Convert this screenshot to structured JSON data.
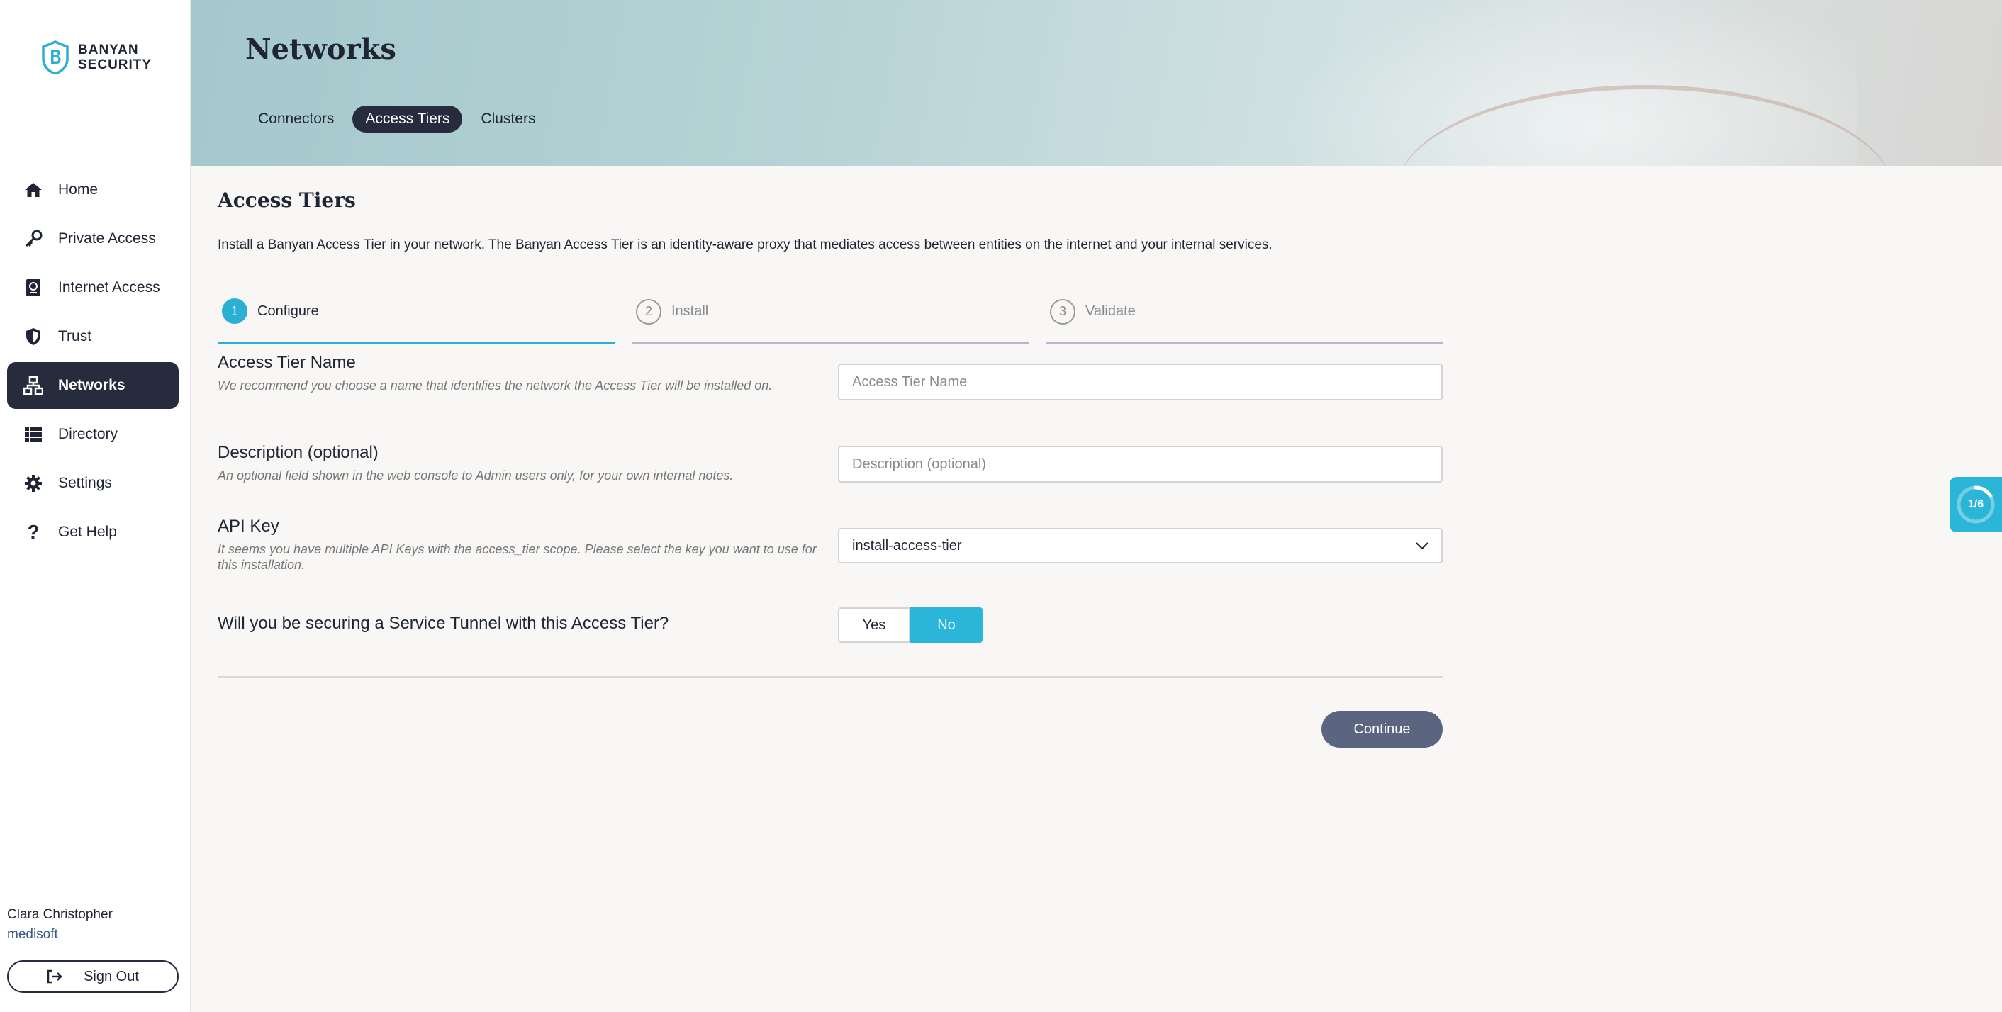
{
  "brand": {
    "line1": "BANYAN",
    "line2": "SECURITY",
    "accent": "#2bafd2"
  },
  "sidebar": {
    "items": [
      {
        "label": "Home",
        "icon": "home-icon"
      },
      {
        "label": "Private Access",
        "icon": "key-icon"
      },
      {
        "label": "Internet Access",
        "icon": "passport-icon"
      },
      {
        "label": "Trust",
        "icon": "shield-icon"
      },
      {
        "label": "Networks",
        "icon": "network-icon",
        "active": true
      },
      {
        "label": "Directory",
        "icon": "list-icon"
      },
      {
        "label": "Settings",
        "icon": "gear-icon"
      },
      {
        "label": "Get Help",
        "icon": "question-icon"
      }
    ],
    "user_name": "Clara Christopher",
    "org": "medisoft",
    "signout_label": "Sign Out"
  },
  "header": {
    "title": "Networks",
    "tabs": [
      {
        "label": "Connectors"
      },
      {
        "label": "Access Tiers",
        "active": true
      },
      {
        "label": "Clusters"
      }
    ]
  },
  "main": {
    "title": "Access Tiers",
    "intro": "Install a Banyan Access Tier in your network. The Banyan Access Tier is an identity-aware proxy that mediates access between entities on the internet and your internal services.",
    "steps": [
      {
        "num": "1",
        "label": "Configure",
        "active": true
      },
      {
        "num": "2",
        "label": "Install"
      },
      {
        "num": "3",
        "label": "Validate"
      }
    ],
    "form": {
      "name": {
        "label": "Access Tier Name",
        "help": "We recommend you choose a name that identifies the network the Access Tier will be installed on.",
        "placeholder": "Access Tier Name",
        "value": ""
      },
      "description": {
        "label": "Description (optional)",
        "help": "An optional field shown in the web console to Admin users only, for your own internal notes.",
        "placeholder": "Description (optional)",
        "value": ""
      },
      "api_key": {
        "label": "API Key",
        "help": "It seems you have multiple API Keys with the access_tier scope. Please select the key you want to use for this installation.",
        "selected": "install-access-tier"
      },
      "service_tunnel": {
        "question": "Will you be securing a Service Tunnel with this Access Tier?",
        "yes_label": "Yes",
        "no_label": "No",
        "selected": "No"
      }
    },
    "continue_label": "Continue"
  },
  "progress_widget": {
    "label": "1/6",
    "fraction": 0.1667
  }
}
